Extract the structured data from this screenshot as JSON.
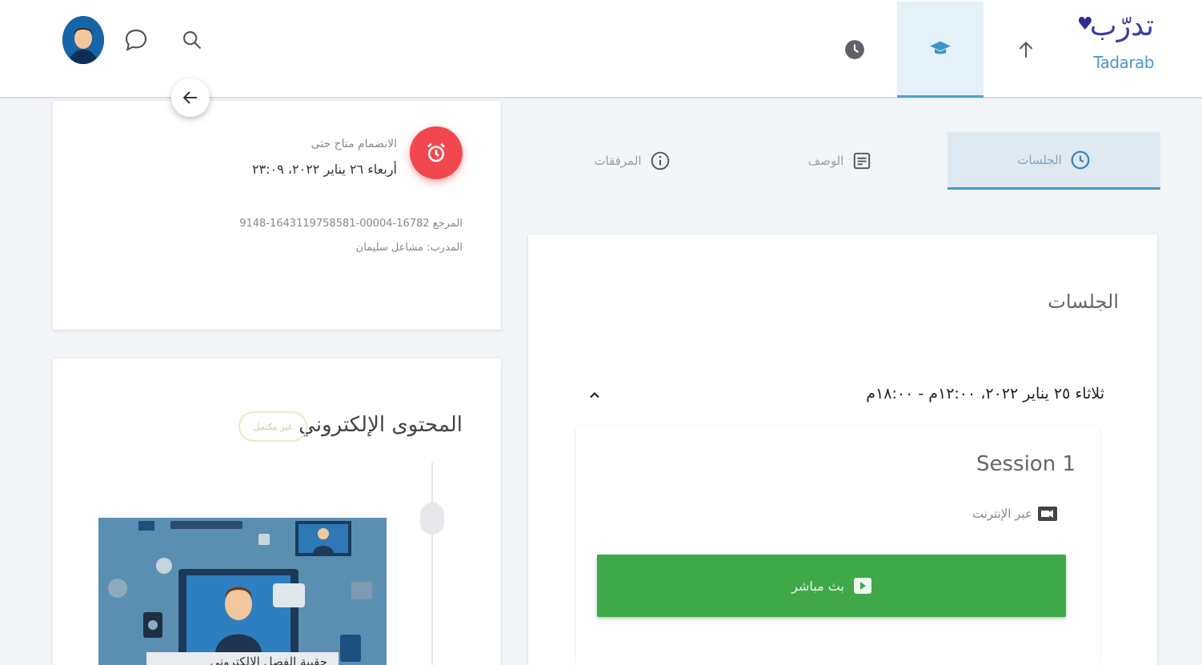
{
  "header": {
    "logo_ar": "تدرّب",
    "logo_en": "Tadarab",
    "nav": [
      {
        "icon": "arrow-up-icon"
      },
      {
        "icon": "graduation-cap-icon",
        "active": true
      },
      {
        "icon": "clock-icon"
      }
    ],
    "actions": [
      {
        "icon": "search-icon"
      },
      {
        "icon": "chat-icon"
      },
      {
        "icon": "avatar"
      }
    ],
    "back_icon": "arrow-left-icon"
  },
  "booking_card": {
    "label": "الانضمام متاح حتى",
    "date": "أربعاء ٢٦ يناير ٢٠٢٢، ٢٣:٠٩",
    "reference": "المرجع 16782-00004-1643119758581-9148",
    "trainer": "المدرب: مشاعل سليمان",
    "icon": "alarm-clock-icon"
  },
  "econtent_card": {
    "title": "المحتوى الإلكتروني",
    "badge": "غير مكتمل",
    "thumbnail_caption": "حقيبة الفصل الإلكتروني"
  },
  "tabs": [
    {
      "label": "الجلسات",
      "icon": "clock-outline-icon",
      "active": true
    },
    {
      "label": "الوصف",
      "icon": "document-icon",
      "active": false
    },
    {
      "label": "المرفقات",
      "icon": "info-icon",
      "active": false
    }
  ],
  "sessions_card": {
    "title": "الجلسات",
    "date_line": "ثلاثاء ٢٥ يناير ٢٠٢٢، ١٢:٠٠م - ١٨:٠٠م",
    "session": {
      "name": "Session 1",
      "mode": "عبر الإنترنت",
      "live_button": "بث مباشر"
    }
  },
  "colors": {
    "brand": "#3c3f9e",
    "accent": "#4aa3d2",
    "alarm": "#f0484e",
    "live": "#3fa94a"
  }
}
